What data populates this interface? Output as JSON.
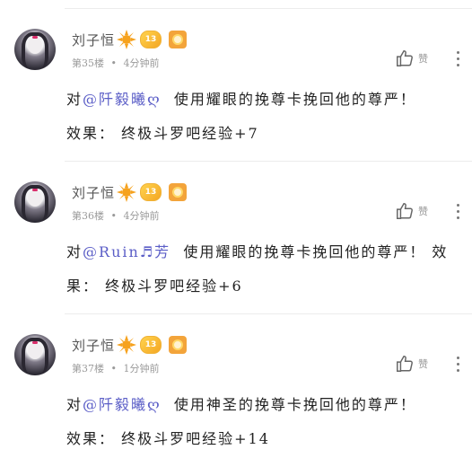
{
  "posts": [
    {
      "username": "刘子恒",
      "level": "13",
      "floor": "第35楼",
      "time": "4分钟前",
      "like_label": "赞",
      "prefix": "对",
      "mention": "@阡毅曦ღ",
      "action": "使用耀眼的挽尊卡挽回他的尊严！",
      "effect_label": "效果：",
      "effect_value": "终极斗罗吧经验+7"
    },
    {
      "username": "刘子恒",
      "level": "13",
      "floor": "第36楼",
      "time": "4分钟前",
      "like_label": "赞",
      "prefix": "对",
      "mention": "@Ruin♬芳",
      "action": "使用耀眼的挽尊卡挽回他的尊严！",
      "effect_label": "效果：",
      "effect_value": "终极斗罗吧经验+6"
    },
    {
      "username": "刘子恒",
      "level": "13",
      "floor": "第37楼",
      "time": "1分钟前",
      "like_label": "赞",
      "prefix": "对",
      "mention": "@阡毅曦ღ",
      "action": "使用神圣的挽尊卡挽回他的尊严！",
      "effect_label": "效果：",
      "effect_value": "终极斗罗吧经验+14"
    }
  ],
  "colors": {
    "mention": "#5b5ec7",
    "meta": "#9a9a9a",
    "badge": "#f4a623"
  },
  "icons": {
    "like": "thumbs-up-icon",
    "more": "more-vertical-icon",
    "sun": "sun-badge-icon"
  }
}
